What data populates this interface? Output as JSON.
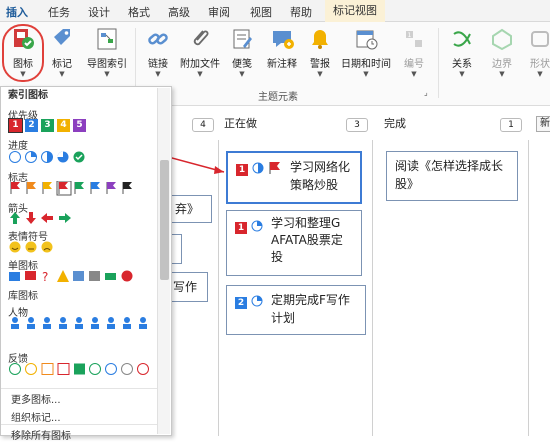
{
  "tabs": [
    "插入",
    "任务",
    "设计",
    "格式",
    "高级",
    "审阅",
    "视图",
    "帮助",
    "标记视图"
  ],
  "ribbon": {
    "buttons": [
      {
        "label": "图标",
        "icon": "icon-mark-icon",
        "disabled": false
      },
      {
        "label": "标记",
        "icon": "tag-icon",
        "disabled": false
      },
      {
        "label": "导图索引",
        "icon": "index-icon",
        "disabled": false
      },
      {
        "label": "链接",
        "icon": "link-icon",
        "disabled": false
      },
      {
        "label": "附加文件",
        "icon": "attachment-icon",
        "disabled": false
      },
      {
        "label": "便笺",
        "icon": "note-icon",
        "disabled": false
      },
      {
        "label": "新注释",
        "icon": "comment-icon",
        "disabled": false
      },
      {
        "label": "警报",
        "icon": "bell-icon",
        "disabled": false
      },
      {
        "label": "日期和时间",
        "icon": "calendar-icon",
        "disabled": false
      },
      {
        "label": "编号",
        "icon": "numbering-icon",
        "disabled": true
      },
      {
        "label": "关系",
        "icon": "relation-icon",
        "disabled": false
      },
      {
        "label": "边界",
        "icon": "boundary-icon",
        "disabled": true
      },
      {
        "label": "形状",
        "icon": "shape-icon",
        "disabled": true
      }
    ],
    "group_label": "主题元素"
  },
  "board": {
    "count_todo": "4",
    "col_doing": "正在做",
    "count_doing": "3",
    "col_done": "完成",
    "count_done": "1",
    "new_btn": "新",
    "cards": [
      {
        "text1": "学习网络化",
        "text2": "策略炒股",
        "priority": "1"
      },
      {
        "text1": "学习和整理G",
        "text2": "AFATA股票定",
        "text3": "投",
        "priority": "1"
      },
      {
        "text1": "定期完成F写作",
        "text2": "计划",
        "priority": "2"
      },
      {
        "text1": "阅读《怎样选择成长",
        "text2": "股》"
      }
    ],
    "partial": [
      "弃》",
      "写作"
    ]
  },
  "panel": {
    "header": "索引图标",
    "sections": [
      "优先级",
      "进度",
      "标志",
      "箭头",
      "表情符号",
      "单图标",
      "库图标",
      "人物",
      "反馈"
    ],
    "more": "更多图标...",
    "organize": "组织标记...",
    "remove": "移除所有图标"
  },
  "colors": {
    "accent": "#1d5b9a",
    "priority1": "#d8262d",
    "priority2": "#2a7de1",
    "priority3": "#1aa25b",
    "priority4": "#f2b100",
    "priority5": "#8c3fbf"
  }
}
